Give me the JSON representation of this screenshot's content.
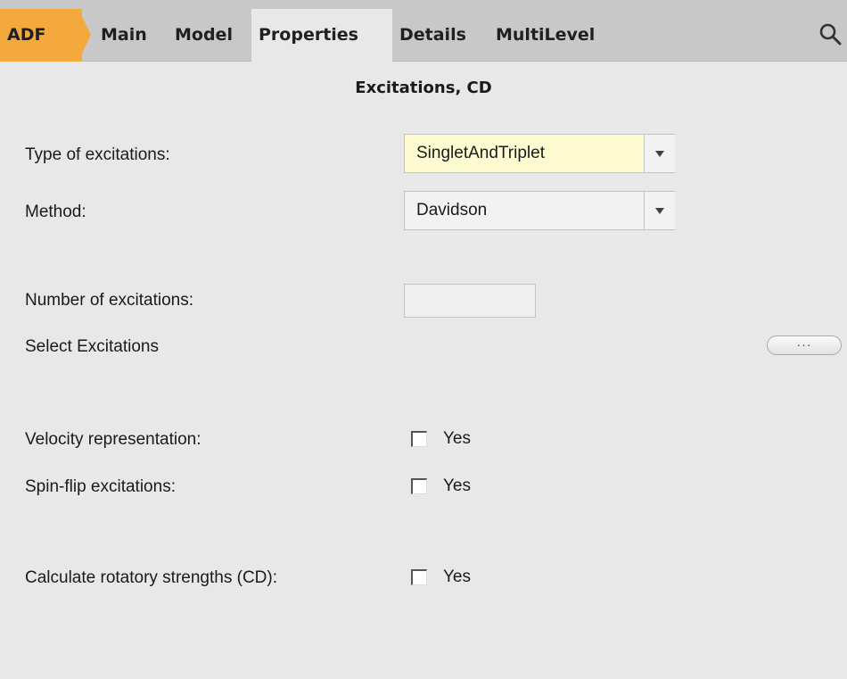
{
  "tabs": {
    "adf": "ADF",
    "main": "Main",
    "model": "Model",
    "properties": "Properties",
    "details": "Details",
    "multilevel": "MultiLevel",
    "active": "Properties",
    "search_icon": "search-icon"
  },
  "colors": {
    "adf_tab": "#f4a93c",
    "bar": "#c8c8c8",
    "panel": "#e8e8e8",
    "highlight_field": "#fffbd0"
  },
  "section": {
    "title": "Excitations, CD"
  },
  "form": {
    "type_of_excitations": {
      "label": "Type of excitations:",
      "value": "SingletAndTriplet"
    },
    "method": {
      "label": "Method:",
      "value": "Davidson"
    },
    "number_of_excitations": {
      "label": "Number of excitations:",
      "value": ""
    },
    "select_excitations": {
      "label": "Select Excitations",
      "button": "···"
    },
    "velocity_representation": {
      "label": "Velocity representation:",
      "checkbox_label": "Yes",
      "checked": false
    },
    "spin_flip_excitations": {
      "label": "Spin-flip excitations:",
      "checkbox_label": "Yes",
      "checked": false
    },
    "calculate_rotatory_strengths": {
      "label": "Calculate rotatory strengths (CD):",
      "checkbox_label": "Yes",
      "checked": false
    }
  }
}
